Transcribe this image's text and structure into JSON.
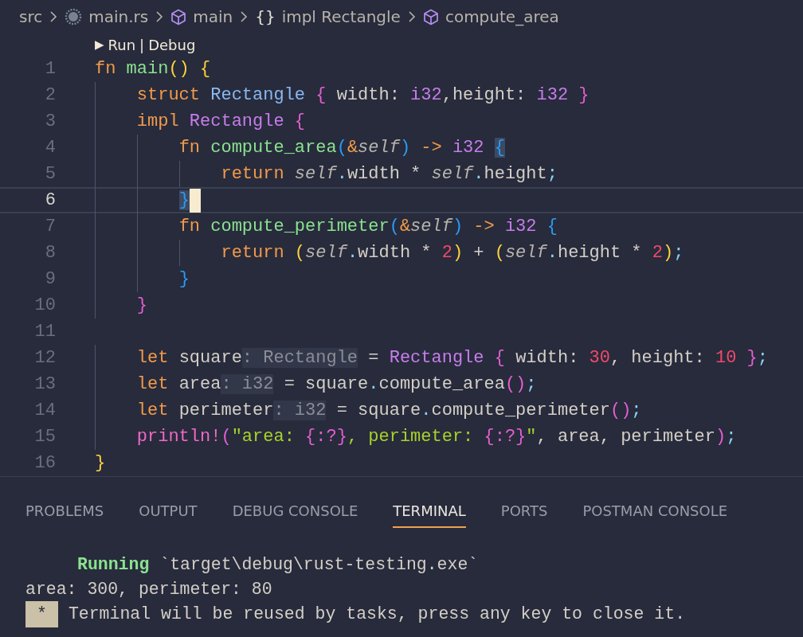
{
  "breadcrumb": [
    {
      "label": "src",
      "kind": "folder"
    },
    {
      "label": "main.rs",
      "kind": "file"
    },
    {
      "label": "main",
      "kind": "module"
    },
    {
      "label": "impl Rectangle",
      "kind": "impl",
      "icon": "{}"
    },
    {
      "label": "compute_area",
      "kind": "method"
    }
  ],
  "codelens": {
    "icon": "▶",
    "actions": [
      "Run",
      "Debug"
    ],
    "separator": "|"
  },
  "editor": {
    "lines": [
      {
        "number": "1",
        "current": false,
        "tokens": [
          {
            "text": "fn ",
            "kind": "kw"
          },
          {
            "text": "main",
            "kind": "fn"
          },
          {
            "text": "() {",
            "kind": "b1"
          }
        ]
      },
      {
        "number": "2",
        "current": false,
        "tokens": [
          {
            "text": "    struct ",
            "kind": "kw"
          },
          {
            "text": "Rectangle ",
            "kind": "struct"
          },
          {
            "text": "{",
            "kind": "b2"
          },
          {
            "text": " width: ",
            "kind": "plain"
          },
          {
            "text": "i32",
            "kind": "type"
          },
          {
            "text": ",height: ",
            "kind": "plain"
          },
          {
            "text": "i32 ",
            "kind": "type"
          },
          {
            "text": "}",
            "kind": "b2"
          }
        ]
      },
      {
        "number": "3",
        "current": false,
        "tokens": [
          {
            "text": "    impl ",
            "kind": "kw"
          },
          {
            "text": "Rectangle ",
            "kind": "type"
          },
          {
            "text": "{",
            "kind": "b2"
          }
        ]
      },
      {
        "number": "4",
        "current": false,
        "tokens": [
          {
            "text": "        fn ",
            "kind": "kw"
          },
          {
            "text": "compute_area",
            "kind": "fn"
          },
          {
            "text": "(",
            "kind": "b3"
          },
          {
            "text": "&",
            "kind": "op"
          },
          {
            "text": "self",
            "kind": "self"
          },
          {
            "text": ")",
            "kind": "b3"
          },
          {
            "text": " -> ",
            "kind": "op"
          },
          {
            "text": "i32 ",
            "kind": "type"
          },
          {
            "text": "{",
            "kind": "match"
          }
        ]
      },
      {
        "number": "5",
        "current": false,
        "tokens": [
          {
            "text": "            return ",
            "kind": "kw"
          },
          {
            "text": "self",
            "kind": "self"
          },
          {
            "text": ".",
            "kind": "punct"
          },
          {
            "text": "width * ",
            "kind": "plain"
          },
          {
            "text": "self",
            "kind": "self"
          },
          {
            "text": ".",
            "kind": "punct"
          },
          {
            "text": "height",
            "kind": "plain"
          },
          {
            "text": ";",
            "kind": "punct"
          }
        ]
      },
      {
        "number": "6",
        "current": true,
        "tokens": [
          {
            "text": "        }",
            "kind": "match"
          }
        ]
      },
      {
        "number": "7",
        "current": false,
        "tokens": [
          {
            "text": "        fn ",
            "kind": "kw"
          },
          {
            "text": "compute_perimeter",
            "kind": "fn"
          },
          {
            "text": "(",
            "kind": "b3"
          },
          {
            "text": "&",
            "kind": "op"
          },
          {
            "text": "self",
            "kind": "self"
          },
          {
            "text": ")",
            "kind": "b3"
          },
          {
            "text": " -> ",
            "kind": "op"
          },
          {
            "text": "i32 ",
            "kind": "type"
          },
          {
            "text": "{",
            "kind": "b3"
          }
        ]
      },
      {
        "number": "8",
        "current": false,
        "tokens": [
          {
            "text": "            return ",
            "kind": "kw"
          },
          {
            "text": "(",
            "kind": "b1"
          },
          {
            "text": "self",
            "kind": "self"
          },
          {
            "text": ".",
            "kind": "punct"
          },
          {
            "text": "width * ",
            "kind": "plain"
          },
          {
            "text": "2",
            "kind": "num"
          },
          {
            "text": ")",
            "kind": "b1"
          },
          {
            "text": " + ",
            "kind": "plain"
          },
          {
            "text": "(",
            "kind": "b1"
          },
          {
            "text": "self",
            "kind": "self"
          },
          {
            "text": ".",
            "kind": "punct"
          },
          {
            "text": "height * ",
            "kind": "plain"
          },
          {
            "text": "2",
            "kind": "num"
          },
          {
            "text": ")",
            "kind": "b1"
          },
          {
            "text": ";",
            "kind": "punct"
          }
        ]
      },
      {
        "number": "9",
        "current": false,
        "tokens": [
          {
            "text": "        }",
            "kind": "b3"
          }
        ]
      },
      {
        "number": "10",
        "current": false,
        "tokens": [
          {
            "text": "    }",
            "kind": "b2"
          }
        ]
      },
      {
        "number": "11",
        "current": false
      },
      {
        "number": "12",
        "current": false,
        "tokens": [
          {
            "text": "    let",
            "kind": "kw"
          },
          {
            "text": " square",
            "kind": "plain"
          },
          {
            "text": ": Rectangle",
            "kind": "hint"
          },
          {
            "text": " = ",
            "kind": "plain"
          },
          {
            "text": "Rectangle ",
            "kind": "type"
          },
          {
            "text": "{",
            "kind": "b2"
          },
          {
            "text": " width: ",
            "kind": "plain"
          },
          {
            "text": "30",
            "kind": "num"
          },
          {
            "text": ", height: ",
            "kind": "plain"
          },
          {
            "text": "10 ",
            "kind": "num"
          },
          {
            "text": "}",
            "kind": "b2"
          },
          {
            "text": ";",
            "kind": "punct"
          }
        ]
      },
      {
        "number": "13",
        "current": false,
        "tokens": [
          {
            "text": "    let",
            "kind": "kw"
          },
          {
            "text": " area",
            "kind": "plain"
          },
          {
            "text": ": i32",
            "kind": "hint"
          },
          {
            "text": " = square",
            "kind": "plain"
          },
          {
            "text": ".",
            "kind": "punct"
          },
          {
            "text": "compute_area",
            "kind": "plain"
          },
          {
            "text": "()",
            "kind": "b2"
          },
          {
            "text": ";",
            "kind": "punct"
          }
        ]
      },
      {
        "number": "14",
        "current": false,
        "tokens": [
          {
            "text": "    let",
            "kind": "kw"
          },
          {
            "text": " perimeter",
            "kind": "plain"
          },
          {
            "text": ": i32",
            "kind": "hint"
          },
          {
            "text": " = square",
            "kind": "plain"
          },
          {
            "text": ".",
            "kind": "punct"
          },
          {
            "text": "compute_perimeter",
            "kind": "plain"
          },
          {
            "text": "()",
            "kind": "b2"
          },
          {
            "text": ";",
            "kind": "punct"
          }
        ]
      },
      {
        "number": "15",
        "current": false,
        "tokens": [
          {
            "text": "    println!",
            "kind": "macro"
          },
          {
            "text": "(",
            "kind": "b2"
          },
          {
            "text": "\"area: ",
            "kind": "str"
          },
          {
            "text": "{:?}",
            "kind": "b2"
          },
          {
            "text": ", perimeter: ",
            "kind": "str"
          },
          {
            "text": "{:?}",
            "kind": "b2"
          },
          {
            "text": "\"",
            "kind": "str"
          },
          {
            "text": ", area, perimeter",
            "kind": "plain"
          },
          {
            "text": ")",
            "kind": "b2"
          },
          {
            "text": ";",
            "kind": "punct"
          }
        ]
      },
      {
        "number": "16",
        "current": false,
        "tokens": [
          {
            "text": "}",
            "kind": "b1"
          }
        ]
      }
    ]
  },
  "panel": {
    "tabs": [
      {
        "label": "PROBLEMS",
        "selected": false
      },
      {
        "label": "OUTPUT",
        "selected": false
      },
      {
        "label": "DEBUG CONSOLE",
        "selected": false
      },
      {
        "label": "TERMINAL",
        "selected": true
      },
      {
        "label": "PORTS",
        "selected": false
      },
      {
        "label": "POSTMAN CONSOLE",
        "selected": false
      }
    ],
    "terminal": [
      {
        "kind": "blank"
      },
      {
        "kind": "status",
        "status": "Running",
        "text": "`target\\debug\\rust-testing.exe`"
      },
      {
        "kind": "plain",
        "text": "area: 300, perimeter: 80"
      },
      {
        "kind": "notice",
        "badge": "*",
        "text": "Terminal will be reused by tasks, press any key to close it."
      }
    ]
  }
}
